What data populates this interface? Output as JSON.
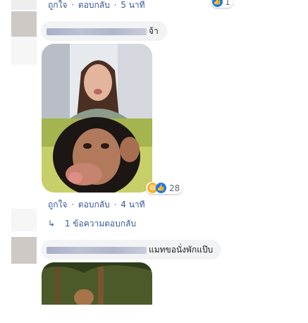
{
  "comments": [
    {
      "meta": {
        "like": "ถูกใจ",
        "reply": "ตอบกลับ",
        "time": "5 นาที"
      },
      "reactions": {
        "count": "1"
      }
    },
    {
      "text_suffix": "จ้า",
      "meta": {
        "like": "ถูกใจ",
        "reply": "ตอบกลับ",
        "time": "4 นาที"
      },
      "reactions": {
        "count": "28"
      },
      "replies_link": "1 ข้อความตอบกลับ"
    },
    {
      "text_suffix": "แมทขอนั่งพักแป๊บ"
    }
  ],
  "separator": "·",
  "colors": {
    "like_blue": "#1877f2",
    "haha_yellow": "#f7b125",
    "bubble_bg": "#f2f3f5",
    "meta_gray": "#606770"
  },
  "icons": {
    "like": "like-reaction-icon",
    "haha": "haha-reaction-icon",
    "reply_arrow": "reply-arrow-icon"
  }
}
